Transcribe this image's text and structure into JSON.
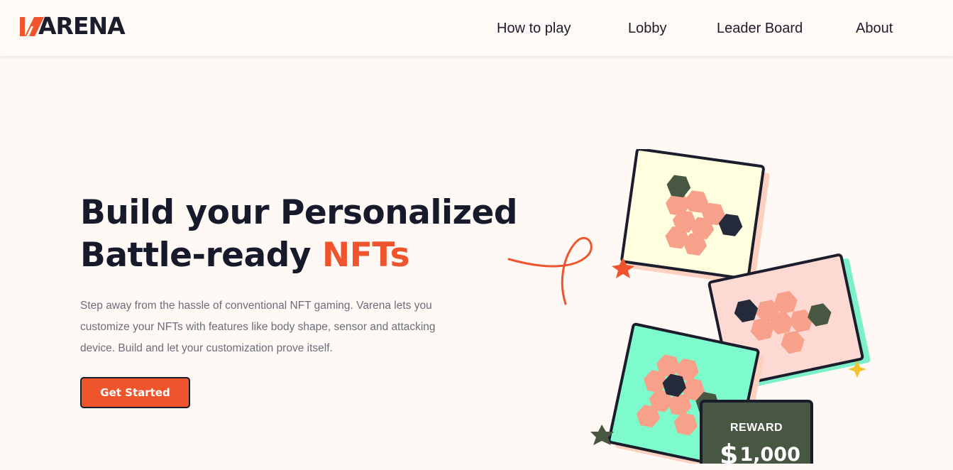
{
  "brand": {
    "name": "ARENA",
    "mark": "V",
    "colors": {
      "accent": "#f0542c",
      "dark": "#1b1d2c",
      "bg": "#fff9f5"
    }
  },
  "nav": {
    "items": [
      "How to play",
      "Lobby",
      "Leader Board",
      "About"
    ]
  },
  "hero": {
    "title_line1": "Build your Personalized",
    "title_line2_prefix": "Battle-ready",
    "title_line2_accent": "NFTs",
    "description": "Step away from the hassle of conventional NFT gaming. Varena lets you customize your NFTs with features like body shape, sensor and attacking device. Build and let your customization prove itself.",
    "cta_label": "Get Started"
  },
  "reward": {
    "label": "REWARD",
    "currency": "$",
    "amount": "1,000"
  }
}
